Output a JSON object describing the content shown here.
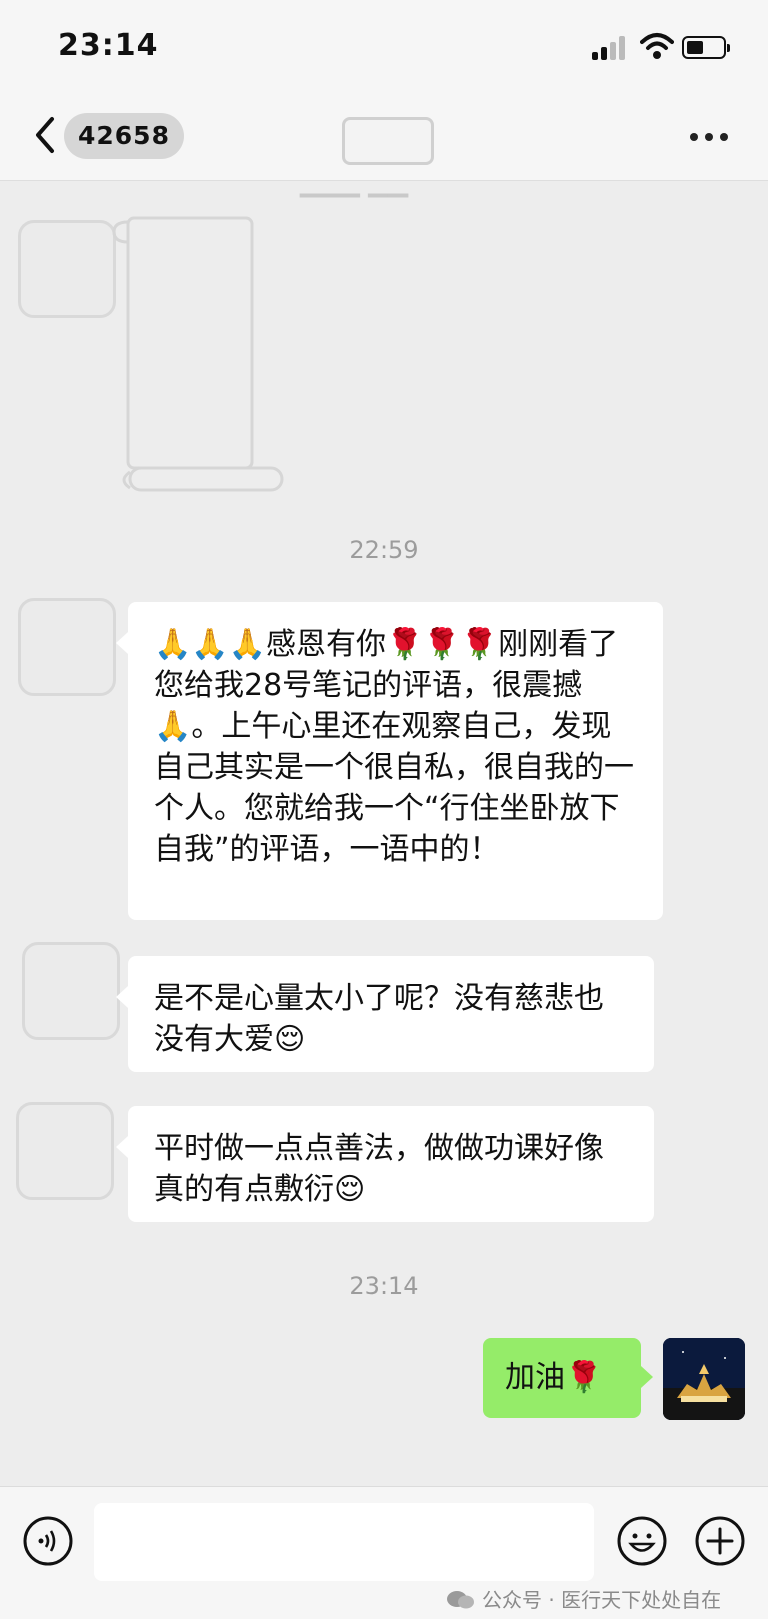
{
  "status_bar": {
    "time": "23:14"
  },
  "nav": {
    "chat_id": "42658"
  },
  "timestamps": [
    "22:59",
    "23:14"
  ],
  "messages": [
    {
      "from": "other",
      "text": "🙏🙏🙏感恩有你🌹🌹🌹刚刚看了您给我28号笔记的评语，很震撼🙏。上午心里还在观察自己，发现自己其实是一个很自私，很自我的一个人。您就给我一个“行住坐卧放下自我”的评语，一语中的！"
    },
    {
      "from": "other",
      "text": "是不是心量太小了呢？没有慈悲也没有大爱😌"
    },
    {
      "from": "other",
      "text": "平时做一点点善法，做做功课好像真的有点敷衍😌"
    },
    {
      "from": "me",
      "text": "加油🌹"
    }
  ],
  "watermark": "公众号 · 医行天下处处自在",
  "colors": {
    "background": "#ededed",
    "my_bubble": "#95ec69",
    "their_bubble": "#ffffff"
  },
  "icons": [
    "back-icon",
    "more-icon",
    "voice-icon",
    "emoji-icon",
    "plus-icon",
    "wechat-icon"
  ]
}
